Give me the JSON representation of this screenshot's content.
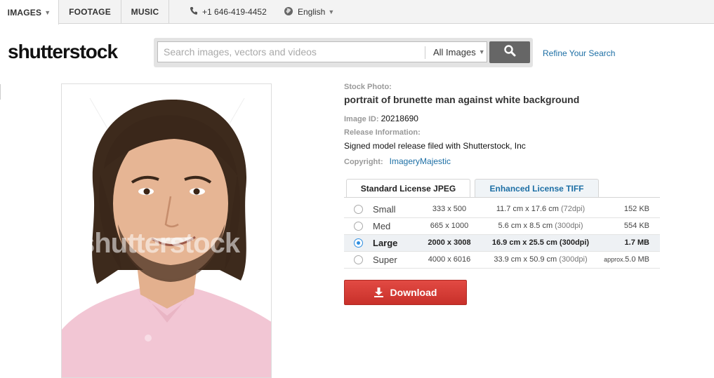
{
  "topnav": {
    "tabs": [
      {
        "label": "IMAGES",
        "caret": "▼"
      },
      {
        "label": "FOOTAGE"
      },
      {
        "label": "MUSIC"
      }
    ],
    "phone": "+1 646-419-4452",
    "language": "English",
    "language_caret": "▼",
    "icons": {
      "phone": "phone-icon",
      "language": "globe-icon"
    }
  },
  "brand": {
    "logo_text": "shutterstock"
  },
  "search": {
    "placeholder": "Search images, vectors and videos",
    "value": "",
    "category": "All Images",
    "category_caret": "▼",
    "button_icon": "search-icon",
    "refine_label": "Refine Your Search"
  },
  "photo": {
    "watermark": "shutterstock"
  },
  "info": {
    "stock_label": "Stock Photo:",
    "title": "portrait of brunette man against white background",
    "image_id_label": "Image ID:",
    "image_id": "20218690",
    "release_label": "Release Information:",
    "release_text": "Signed model release filed with Shutterstock, Inc",
    "copyright_label": "Copyright:",
    "copyright_holder": "ImageryMajestic"
  },
  "license": {
    "tabs": [
      "Standard License JPEG",
      "Enhanced License TIFF"
    ],
    "active_tab": 0
  },
  "sizes": [
    {
      "name": "Small",
      "px": "333 x 500",
      "cm": "11.7 cm x 17.6 cm",
      "dpi": "(72dpi)",
      "filesize": "152 KB",
      "selected": false
    },
    {
      "name": "Med",
      "px": "665 x 1000",
      "cm": "5.6 cm x 8.5 cm",
      "dpi": "(300dpi)",
      "filesize": "554 KB",
      "selected": false
    },
    {
      "name": "Large",
      "px": "2000 x 3008",
      "cm": "16.9 cm x 25.5 cm",
      "dpi": "(300dpi)",
      "filesize": "1.7 MB",
      "selected": true
    },
    {
      "name": "Super",
      "px": "4000 x 6016",
      "cm": "33.9 cm x 50.9 cm",
      "dpi": "(300dpi)",
      "approx": "approx.",
      "filesize": "5.0 MB",
      "selected": false
    }
  ],
  "download": {
    "label": "Download",
    "icon": "download-icon"
  },
  "colors": {
    "accent_link": "#1d6fa5",
    "download_red": "#d23a33",
    "radio_blue": "#2f8ee0"
  }
}
